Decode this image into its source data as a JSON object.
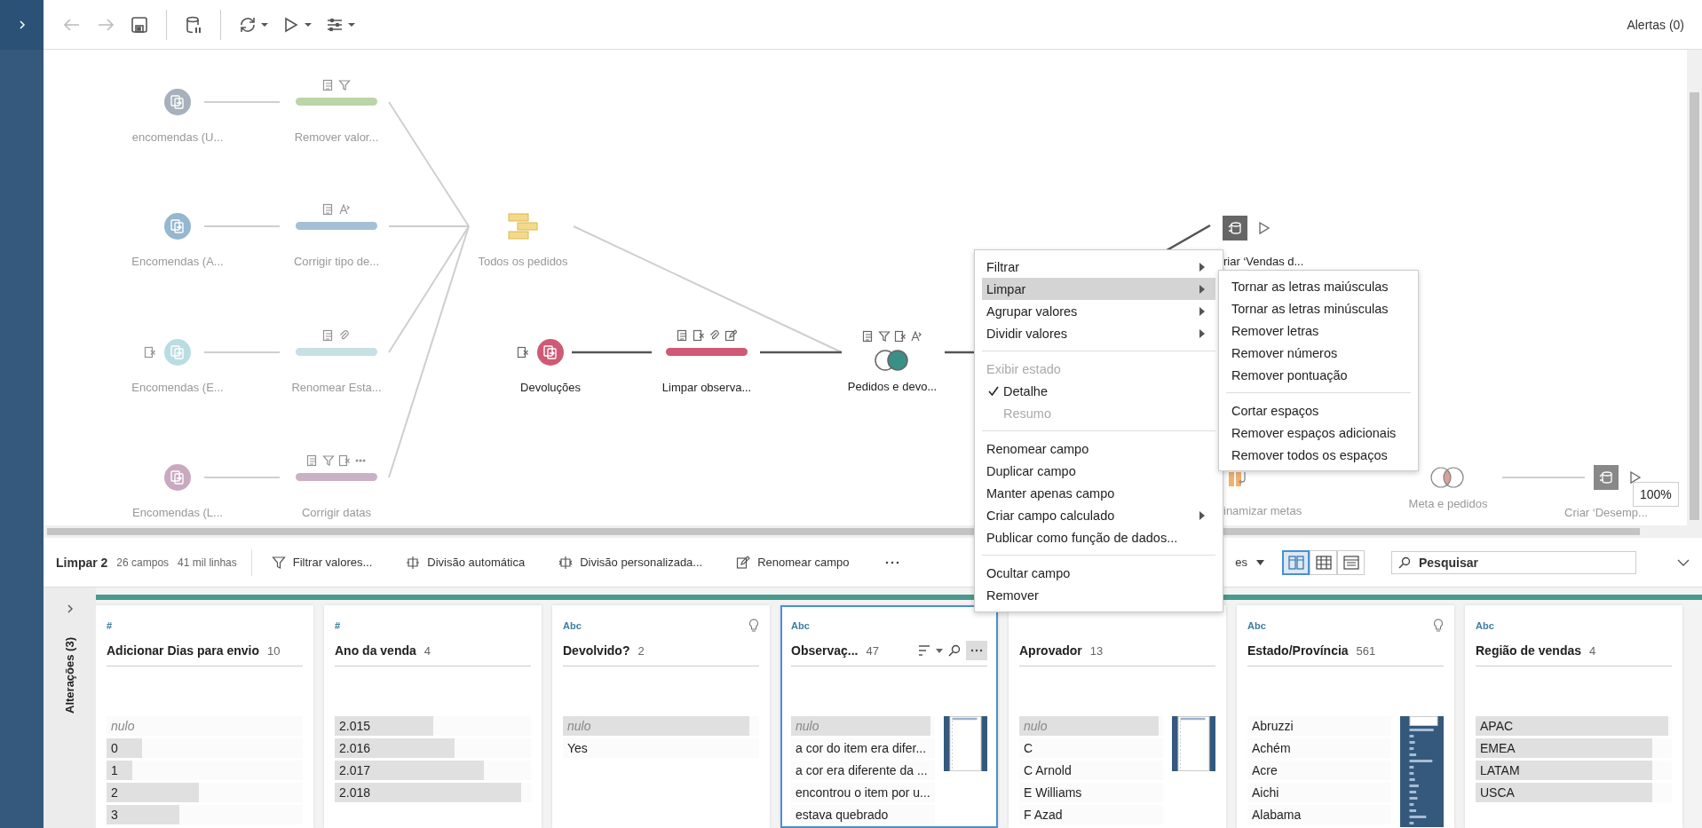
{
  "toolbar": {
    "groups": [
      {
        "buttons": [
          {
            "kind": "back",
            "disabled": true,
            "dropdown": false
          },
          {
            "kind": "forward",
            "disabled": true,
            "dropdown": false
          },
          {
            "kind": "save",
            "disabled": false,
            "dropdown": false
          }
        ]
      },
      {
        "buttons": [
          {
            "kind": "pause-data",
            "disabled": false,
            "dropdown": false
          }
        ]
      },
      {
        "buttons": [
          {
            "kind": "refresh",
            "disabled": false,
            "dropdown": true
          },
          {
            "kind": "run",
            "disabled": false,
            "dropdown": true
          },
          {
            "kind": "options",
            "disabled": false,
            "dropdown": true
          }
        ]
      }
    ],
    "alerts": "Alertas (0)"
  },
  "flow": {
    "nodes": [
      {
        "kind": "input",
        "label": "encomendas (U...",
        "color": "#a7b0bb",
        "faded": true
      },
      {
        "kind": "clean",
        "label": "Remover valor...",
        "color": "#bcd5a8",
        "faded": true,
        "changes": [
          {
            "kind": "fields"
          },
          {
            "kind": "filter"
          }
        ]
      },
      {
        "kind": "input",
        "label": "Encomendas (A...",
        "color": "#95b7cf",
        "faded": true
      },
      {
        "kind": "clean",
        "label": "Corrigir tipo de...",
        "color": "#a3c0d6",
        "faded": true,
        "changes": [
          {
            "kind": "fields"
          },
          {
            "kind": "calc"
          }
        ]
      },
      {
        "kind": "input",
        "label": "Encomendas (E...",
        "color": "#b9dde3",
        "faded": true,
        "changes": [
          {
            "kind": "remove"
          }
        ]
      },
      {
        "kind": "clean",
        "label": "Renomear Esta...",
        "color": "#c6e0e4",
        "faded": true,
        "changes": [
          {
            "kind": "fields"
          },
          {
            "kind": "group"
          }
        ]
      },
      {
        "kind": "input",
        "label": "Encomendas (L...",
        "color": "#c8a9c0",
        "faded": true
      },
      {
        "kind": "clean",
        "label": "Corrigir datas",
        "color": "#c9b2c6",
        "faded": true,
        "changes": [
          {
            "kind": "fields"
          },
          {
            "kind": "filter"
          },
          {
            "kind": "remove"
          },
          {
            "kind": "more"
          }
        ]
      },
      {
        "kind": "union",
        "label": "Todos os pedidos",
        "color": "#f5d98a",
        "faded": true
      },
      {
        "kind": "input",
        "label": "Devoluções",
        "color": "#cf5a75",
        "faded": false,
        "changes": [
          {
            "kind": "remove"
          }
        ]
      },
      {
        "kind": "clean",
        "label": "Limpar observa...",
        "color": "#cf5a75",
        "faded": false,
        "changes": [
          {
            "kind": "fields"
          },
          {
            "kind": "remove"
          },
          {
            "kind": "group"
          },
          {
            "kind": "edit"
          }
        ]
      },
      {
        "kind": "right-join",
        "label": "Pedidos e devo...",
        "color": "#3a8f87",
        "faded": false,
        "changes": [
          {
            "kind": "fields"
          },
          {
            "kind": "filter"
          },
          {
            "kind": "remove"
          },
          {
            "kind": "calc"
          }
        ]
      },
      {
        "kind": "output",
        "label": "riar ‘Vendas d...",
        "color": "#666666",
        "faded": false
      },
      {
        "kind": "pivot",
        "label": "inamizar metas",
        "color": "#f0b070",
        "faded": true
      },
      {
        "kind": "inner-join",
        "label": "Meta e pedidos",
        "color": "#d9a096",
        "faded": true
      },
      {
        "kind": "output",
        "label": "Criar ‘Desemp...",
        "color": "#888888",
        "faded": true
      }
    ],
    "zoom_badge": "100%"
  },
  "context_menu": {
    "groups": [
      {
        "items": [
          {
            "label": "Filtrar",
            "kind": "action",
            "submenu": true,
            "highlighted": false,
            "disabled": false
          },
          {
            "label": "Limpar",
            "kind": "action",
            "submenu": true,
            "highlighted": true,
            "disabled": false
          },
          {
            "label": "Agrupar valores",
            "kind": "action",
            "submenu": true,
            "highlighted": false,
            "disabled": false
          },
          {
            "label": "Dividir valores",
            "kind": "action",
            "submenu": true,
            "highlighted": false,
            "disabled": false
          }
        ]
      },
      {
        "items": [
          {
            "label": "Exibir estado",
            "kind": "header",
            "submenu": false,
            "highlighted": false,
            "disabled": true
          },
          {
            "label": "Detalhe",
            "kind": "option",
            "checked": true,
            "submenu": false,
            "highlighted": false,
            "disabled": false
          },
          {
            "label": "Resumo",
            "kind": "option",
            "checked": false,
            "submenu": false,
            "highlighted": false,
            "disabled": true
          }
        ]
      },
      {
        "items": [
          {
            "label": "Renomear campo",
            "kind": "action",
            "submenu": false,
            "highlighted": false,
            "disabled": false
          },
          {
            "label": "Duplicar campo",
            "kind": "action",
            "submenu": false,
            "highlighted": false,
            "disabled": false
          },
          {
            "label": "Manter apenas campo",
            "kind": "action",
            "submenu": false,
            "highlighted": false,
            "disabled": false
          },
          {
            "label": "Criar campo calculado",
            "kind": "action",
            "submenu": true,
            "highlighted": false,
            "disabled": false
          },
          {
            "label": "Publicar como função de dados...",
            "kind": "action",
            "submenu": false,
            "highlighted": false,
            "disabled": false
          }
        ]
      },
      {
        "items": [
          {
            "label": "Ocultar campo",
            "kind": "action",
            "submenu": false,
            "highlighted": false,
            "disabled": false
          },
          {
            "label": "Remover",
            "kind": "action",
            "submenu": false,
            "highlighted": false,
            "disabled": false
          }
        ]
      }
    ]
  },
  "submenu": {
    "groups": [
      {
        "items": [
          "Tornar as letras maiúsculas",
          "Tornar as letras minúsculas",
          "Remover letras",
          "Remover números",
          "Remover pontuação"
        ]
      },
      {
        "items": [
          "Cortar espaços",
          "Remover espaços adicionais",
          "Remover todos os espaços"
        ]
      }
    ]
  },
  "profile": {
    "title": "Limpar 2",
    "field_count": "26 campos",
    "row_count": "41 mil linhas",
    "actions": [
      {
        "kind": "filter",
        "label": "Filtrar valores..."
      },
      {
        "kind": "auto-split",
        "label": "Divisão automática"
      },
      {
        "kind": "custom-split",
        "label": "Divisão personalizada..."
      },
      {
        "kind": "rename",
        "label": "Renomear campo"
      }
    ],
    "partial_label": "es",
    "views": [
      {
        "kind": "cards",
        "selected": true
      },
      {
        "kind": "table",
        "selected": false
      },
      {
        "kind": "list",
        "selected": false
      }
    ],
    "search": {
      "placeholder": "Pesquisar"
    }
  },
  "changes_panel": {
    "label": "Alterações (3)"
  },
  "cards": [
    {
      "type": "#",
      "name": "Adicionar Dias para envio",
      "count": "10",
      "selected": false,
      "recommendation": false,
      "values": [
        {
          "text": "nulo",
          "is_null": true,
          "level": 0
        },
        {
          "text": "0",
          "is_null": false,
          "level": 0.18
        },
        {
          "text": "1",
          "is_null": false,
          "level": 0.13
        },
        {
          "text": "2",
          "is_null": false,
          "level": 0.47
        },
        {
          "text": "3",
          "is_null": false,
          "level": 0.37
        }
      ]
    },
    {
      "type": "#",
      "name": "Ano da venda",
      "count": "4",
      "selected": false,
      "recommendation": false,
      "values": [
        {
          "text": "2.015",
          "is_null": false,
          "level": 0.5
        },
        {
          "text": "2.016",
          "is_null": false,
          "level": 0.61
        },
        {
          "text": "2.017",
          "is_null": false,
          "level": 0.76
        },
        {
          "text": "2.018",
          "is_null": false,
          "level": 0.95
        }
      ]
    },
    {
      "type": "Abc",
      "name": "Devolvido?",
      "count": "2",
      "selected": false,
      "recommendation": true,
      "values": [
        {
          "text": "nulo",
          "is_null": true,
          "level": 0.95
        },
        {
          "text": "Yes",
          "is_null": false,
          "level": 0
        }
      ]
    },
    {
      "type": "Abc",
      "name": "Observaç...",
      "count": "47",
      "selected": true,
      "recommendation": false,
      "overview": {
        "kind": "scroll"
      },
      "values": [
        {
          "text": "nulo",
          "is_null": true,
          "level": 0.97
        },
        {
          "text": "a cor do item era difer...",
          "is_null": false,
          "level": 0
        },
        {
          "text": "a cor era diferente da ...",
          "is_null": false,
          "level": 0
        },
        {
          "text": "encontrou o item por u...",
          "is_null": false,
          "level": 0
        },
        {
          "text": "estava quebrado",
          "is_null": false,
          "level": 0
        }
      ]
    },
    {
      "name": "Aprovador",
      "count": "13",
      "selected": false,
      "recommendation": false,
      "overview": {
        "kind": "scroll"
      },
      "values": [
        {
          "text": "nulo",
          "is_null": true,
          "level": 0.97
        },
        {
          "text": "C",
          "is_null": false,
          "level": 0
        },
        {
          "text": "C Arnold",
          "is_null": false,
          "level": 0
        },
        {
          "text": "E Williams",
          "is_null": false,
          "level": 0
        },
        {
          "text": "F Azad",
          "is_null": false,
          "level": 0
        }
      ]
    },
    {
      "type": "Abc",
      "name": "Estado/Província",
      "count": "561",
      "selected": false,
      "recommendation": true,
      "overview": {
        "kind": "histogram"
      },
      "values": [
        {
          "text": "Abruzzi",
          "is_null": false,
          "level": 0
        },
        {
          "text": "Achém",
          "is_null": false,
          "level": 0
        },
        {
          "text": "Acre",
          "is_null": false,
          "level": 0
        },
        {
          "text": "Aichi",
          "is_null": false,
          "level": 0
        },
        {
          "text": "Alabama",
          "is_null": false,
          "level": 0
        }
      ]
    },
    {
      "type": "Abc",
      "name": "Região de vendas",
      "count": "4",
      "selected": false,
      "recommendation": false,
      "values": [
        {
          "text": "APAC",
          "is_null": false,
          "level": 0.98
        },
        {
          "text": "EMEA",
          "is_null": false,
          "level": 0.9
        },
        {
          "text": "LATAM",
          "is_null": false,
          "level": 0.9
        },
        {
          "text": "USCA",
          "is_null": false,
          "level": 0.9
        }
      ]
    }
  ]
}
